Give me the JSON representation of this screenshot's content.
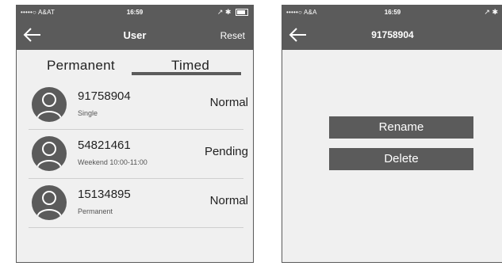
{
  "left_screen": {
    "status": {
      "carrier": "•••••○ A&AT",
      "time": "16:59",
      "right": "↗ ✱"
    },
    "navbar": {
      "title": "User",
      "reset_label": "Reset"
    },
    "tabs": {
      "permanent": "Permanent",
      "timed": "Timed"
    },
    "users": [
      {
        "name": "91758904",
        "sub": "Single",
        "status": "Normal"
      },
      {
        "name": "54821461",
        "sub": "Weekend 10:00-11:00",
        "status": "Pending"
      },
      {
        "name": "15134895",
        "sub": "Permanent",
        "status": "Normal"
      }
    ]
  },
  "right_screen": {
    "status": {
      "carrier": "•••••○ A&A",
      "time": "16:59",
      "right": "↗ ✱"
    },
    "navbar": {
      "title": "91758904"
    },
    "actions": {
      "rename": "Rename",
      "delete": "Delete"
    }
  },
  "colors": {
    "bar": "#5b5b5b",
    "background": "#f0f0f0",
    "button": "#5b5b5b"
  }
}
